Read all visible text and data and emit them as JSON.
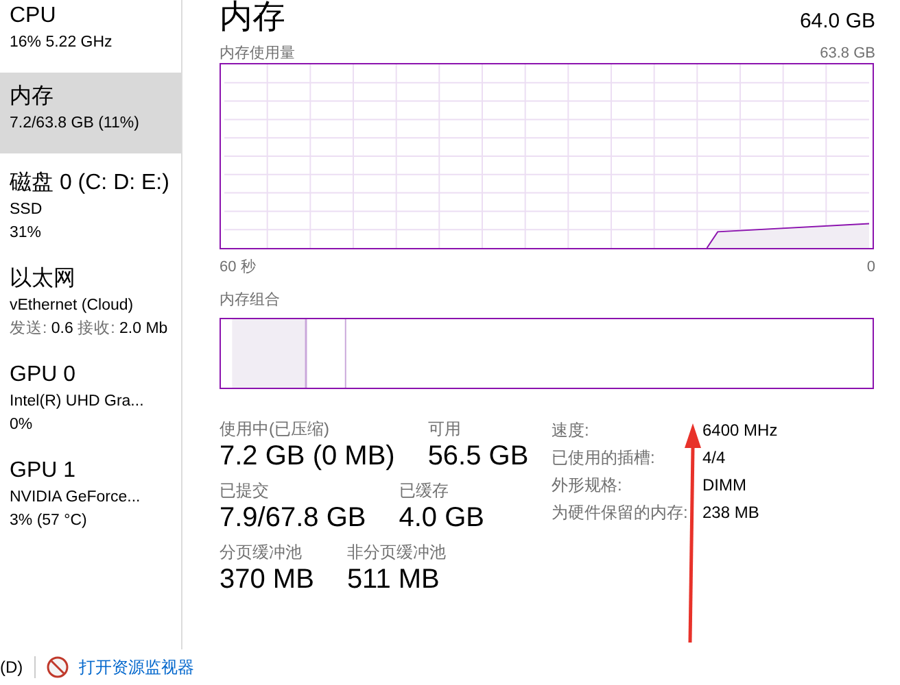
{
  "sidebar": {
    "items": [
      {
        "title": "CPU",
        "lines": [
          "16% 5.22 GHz"
        ],
        "selected": false
      },
      {
        "title": "内存",
        "lines": [
          "7.2/63.8 GB (11%)"
        ],
        "selected": true
      },
      {
        "title": "磁盘 0 (C: D: E:)",
        "lines": [
          "SSD",
          "31%"
        ],
        "selected": false
      },
      {
        "title": "以太网",
        "lines": [
          "vEthernet (Cloud)"
        ],
        "traffic": {
          "send_label": "发送:",
          "send": "0.6",
          "recv_label": "接收:",
          "recv": "2.0 Mb"
        },
        "selected": false
      },
      {
        "title": "GPU 0",
        "lines": [
          "Intel(R) UHD Gra...",
          "0%"
        ],
        "selected": false
      },
      {
        "title": "GPU 1",
        "lines": [
          "NVIDIA GeForce...",
          "3% (57 °C)"
        ],
        "selected": false
      }
    ]
  },
  "header": {
    "title": "内存",
    "total": "64.0 GB"
  },
  "usage_chart": {
    "label": "内存使用量",
    "max": "63.8 GB",
    "x_start": "60 秒",
    "x_end": "0"
  },
  "composition": {
    "label": "内存组合"
  },
  "stats": [
    [
      {
        "label": "使用中(已压缩)",
        "value": "7.2 GB (0 MB)"
      },
      {
        "label": "可用",
        "value": "56.5 GB"
      }
    ],
    [
      {
        "label": "已提交",
        "value": "7.9/67.8 GB"
      },
      {
        "label": "已缓存",
        "value": "4.0 GB"
      }
    ],
    [
      {
        "label": "分页缓冲池",
        "value": "370 MB"
      },
      {
        "label": "非分页缓冲池",
        "value": "511 MB"
      }
    ]
  ],
  "details": [
    {
      "label": "速度:",
      "value": "6400 MHz"
    },
    {
      "label": "已使用的插槽:",
      "value": "4/4"
    },
    {
      "label": "外形规格:",
      "value": "DIMM"
    },
    {
      "label": "为硬件保留的内存:",
      "value": "238 MB"
    }
  ],
  "footer": {
    "fewer_details": "(D)",
    "link": "打开资源监视器"
  }
}
